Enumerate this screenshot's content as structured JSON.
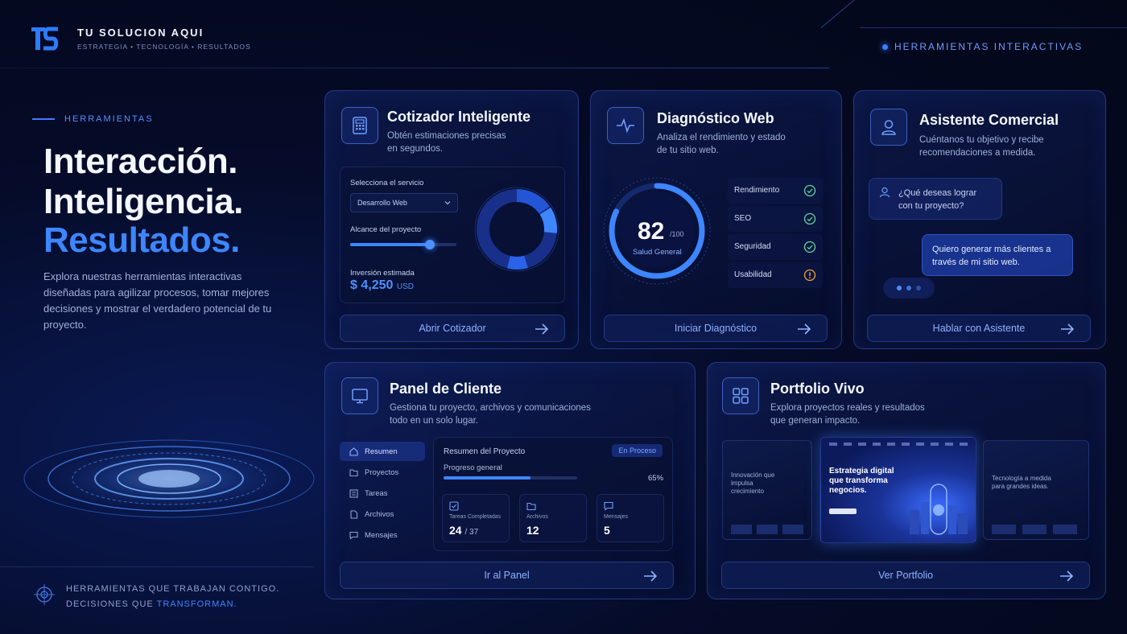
{
  "header": {
    "brand_title": "TU SOLUCION AQUI",
    "brand_subtitle": "ESTRATEGIA • TECNOLOGÍA • RESULTADOS",
    "tools_tag": "HERRAMIENTAS INTERACTIVAS"
  },
  "hero": {
    "eyebrow": "HERRAMIENTAS",
    "line1": "Interacción.",
    "line2": "Inteligencia.",
    "line3": "Resultados.",
    "description": "Explora nuestras herramientas interactivas diseñadas para agilizar procesos, tomar mejores decisiones y mostrar el verdadero potencial de tu proyecto.",
    "tagline_line1": "HERRAMIENTAS QUE TRABAJAN CONTIGO.",
    "tagline_line2_prefix": "DECISIONES QUE ",
    "tagline_line2_highlight": "TRANSFORMAN."
  },
  "cotizador": {
    "title": "Cotizador Inteligente",
    "desc_line1": "Obtén estimaciones precisas",
    "desc_line2": "en segundos.",
    "service_label": "Selecciona el servicio",
    "service_value": "Desarrollo Web",
    "scope_label": "Alcance del proyecto",
    "scope_level": 0.75,
    "investment_label": "Inversión estimada",
    "investment_value": "$ 4,250",
    "investment_currency": "USD",
    "button": "Abrir Cotizador"
  },
  "diagnostico": {
    "title": "Diagnóstico Web",
    "desc_line1": "Analiza el rendimiento y estado",
    "desc_line2": "de tu sitio web.",
    "score": "82",
    "score_of": "/100",
    "score_label": "Salud General",
    "score_fraction": 0.82,
    "metrics": [
      {
        "label": "Rendimiento",
        "status": "ok"
      },
      {
        "label": "SEO",
        "status": "ok"
      },
      {
        "label": "Seguridad",
        "status": "ok"
      },
      {
        "label": "Usabilidad",
        "status": "warning"
      }
    ],
    "button": "Iniciar Diagnóstico"
  },
  "asistente": {
    "title": "Asistente Comercial",
    "desc_line1": "Cuéntanos tu objetivo y recibe",
    "desc_line2": "recomendaciones a medida.",
    "question": "¿Qué deseas lograr con tu proyecto?",
    "answer": "Quiero generar más clientes a través de mi sitio web.",
    "button": "Hablar con Asistente"
  },
  "panel": {
    "title": "Panel de Cliente",
    "desc_line1": "Gestiona tu proyecto, archivos y comunicaciones",
    "desc_line2": "todo en un solo lugar.",
    "nav": [
      "Resumen",
      "Proyectos",
      "Tareas",
      "Archivos",
      "Mensajes"
    ],
    "summary_title": "Resumen del Proyecto",
    "status_badge": "En Proceso",
    "progress_label": "Progreso general",
    "progress_value": "65%",
    "progress_fraction": 0.65,
    "stats": [
      {
        "label": "Tareas Completadas",
        "value": "24",
        "of": "/ 37"
      },
      {
        "label": "Archivos",
        "value": "12",
        "of": ""
      },
      {
        "label": "Mensajes",
        "value": "5",
        "of": ""
      }
    ],
    "button": "Ir al Panel"
  },
  "portfolio": {
    "title": "Portfolio Vivo",
    "desc_line1": "Explora proyectos reales y resultados",
    "desc_line2": "que generan impacto.",
    "shot_left_text": "Innovación que impulsa crecimiento",
    "shot_center_text": "Estrategia digital que transforma negocios.",
    "shot_right_text": "Tecnología a medida para grandes ideas.",
    "button": "Ver Portfolio"
  },
  "colors": {
    "accent": "#3d86ff",
    "background": "#050b28",
    "warning": "#f0a23a"
  }
}
